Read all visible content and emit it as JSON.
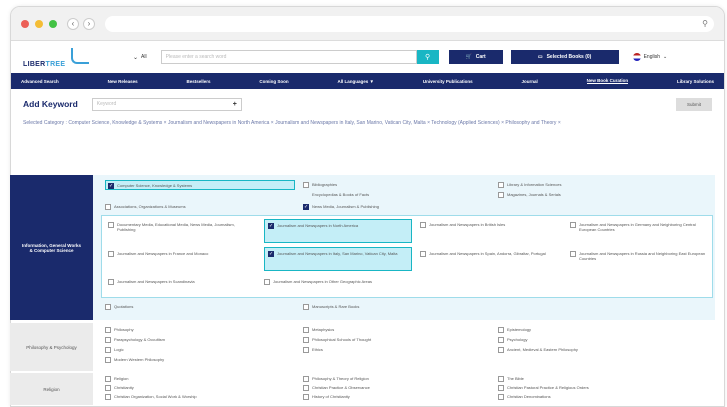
{
  "browser": {
    "back": "‹",
    "forward": "›",
    "search_icon": "search-icon"
  },
  "logo": {
    "part1": "LIBER",
    "part2": "TREE"
  },
  "header": {
    "select_value": "All",
    "search_placeholder": "Please enter a search word",
    "cart": "Cart",
    "selected_books": "Selected Books (0)",
    "language": "English"
  },
  "nav": [
    "Advanced Search",
    "New Releases",
    "Bestsellers",
    "Coming Soon",
    "All Languages ▼",
    "University Publications",
    "Journal",
    "New Book Curation",
    "Library Solutions"
  ],
  "keyword": {
    "title": "Add Keyword",
    "placeholder": "Keyword",
    "button": "Submit"
  },
  "selected_category": {
    "label": "Selected Category :",
    "items": "Computer Science, Knowledge & Systems  ×  Journalism and Newspapers in North America  ×  Journalism and Newspapers in Italy, San Marino, Vatican City, Malta  ×  Technology (Applied Sciences)  ×  Philosophy and Theory  ×"
  },
  "sections": {
    "info": "Information, General Works & Computer Science",
    "philosophy": "Philosophy & Psychology",
    "religion": "Religion"
  },
  "info_items": {
    "c1": "Computer Science, Knowledge & Systems",
    "c2": "Bibliographies",
    "c3": "Library & Information Sciences",
    "c4": "Encyclopedias & Books of Facts",
    "c5": "Magazines, Journals & Serials",
    "c6": "Associations, Organizations & Museums",
    "c7": "News Media, Journalism & Publishing",
    "n1": "Documentary Media, Educational Media, News Media, Journalism, Publishing",
    "n2": "Journalism and Newspapers in North America",
    "n3": "Journalism and Newspapers in British Isles",
    "n4": "Journalism and Newspapers in Germany and Neighboring Central European Countries",
    "n5": "Journalism and Newspapers in France and Monaco",
    "n6": "Journalism and Newspapers in Italy, San Marino, Vatican City, Malta",
    "n7": "Journalism and Newspapers in Spain, Andorra, Gibraltar, Portugal",
    "n8": "Journalism and Newspapers in Russia and Neighboring East European Countries",
    "n9": "Journalism and Newspapers in Scandinavia",
    "n10": "Journalism and Newspapers in Other Geographic Areas",
    "c8": "Quotations",
    "c9": "Manuscripts & Rare Books"
  },
  "philo_items": [
    "Philosophy",
    "Metaphysics",
    "Epistemology",
    "Parapsychology & Occultism",
    "Philosophical Schools of Thought",
    "Psychology",
    "Logic",
    "Ethics",
    "Ancient, Medieval & Eastern Philosophy",
    "Modern Western Philosophy"
  ],
  "religion_items": [
    "Religion",
    "Philosophy & Theory of Religion",
    "The Bible",
    "Christianity",
    "Christian Practice & Observance",
    "Christian Pastoral Practice & Religious Orders",
    "Christian Organization, Social Work & Worship",
    "History of Christianity",
    "Christian Denominations"
  ]
}
